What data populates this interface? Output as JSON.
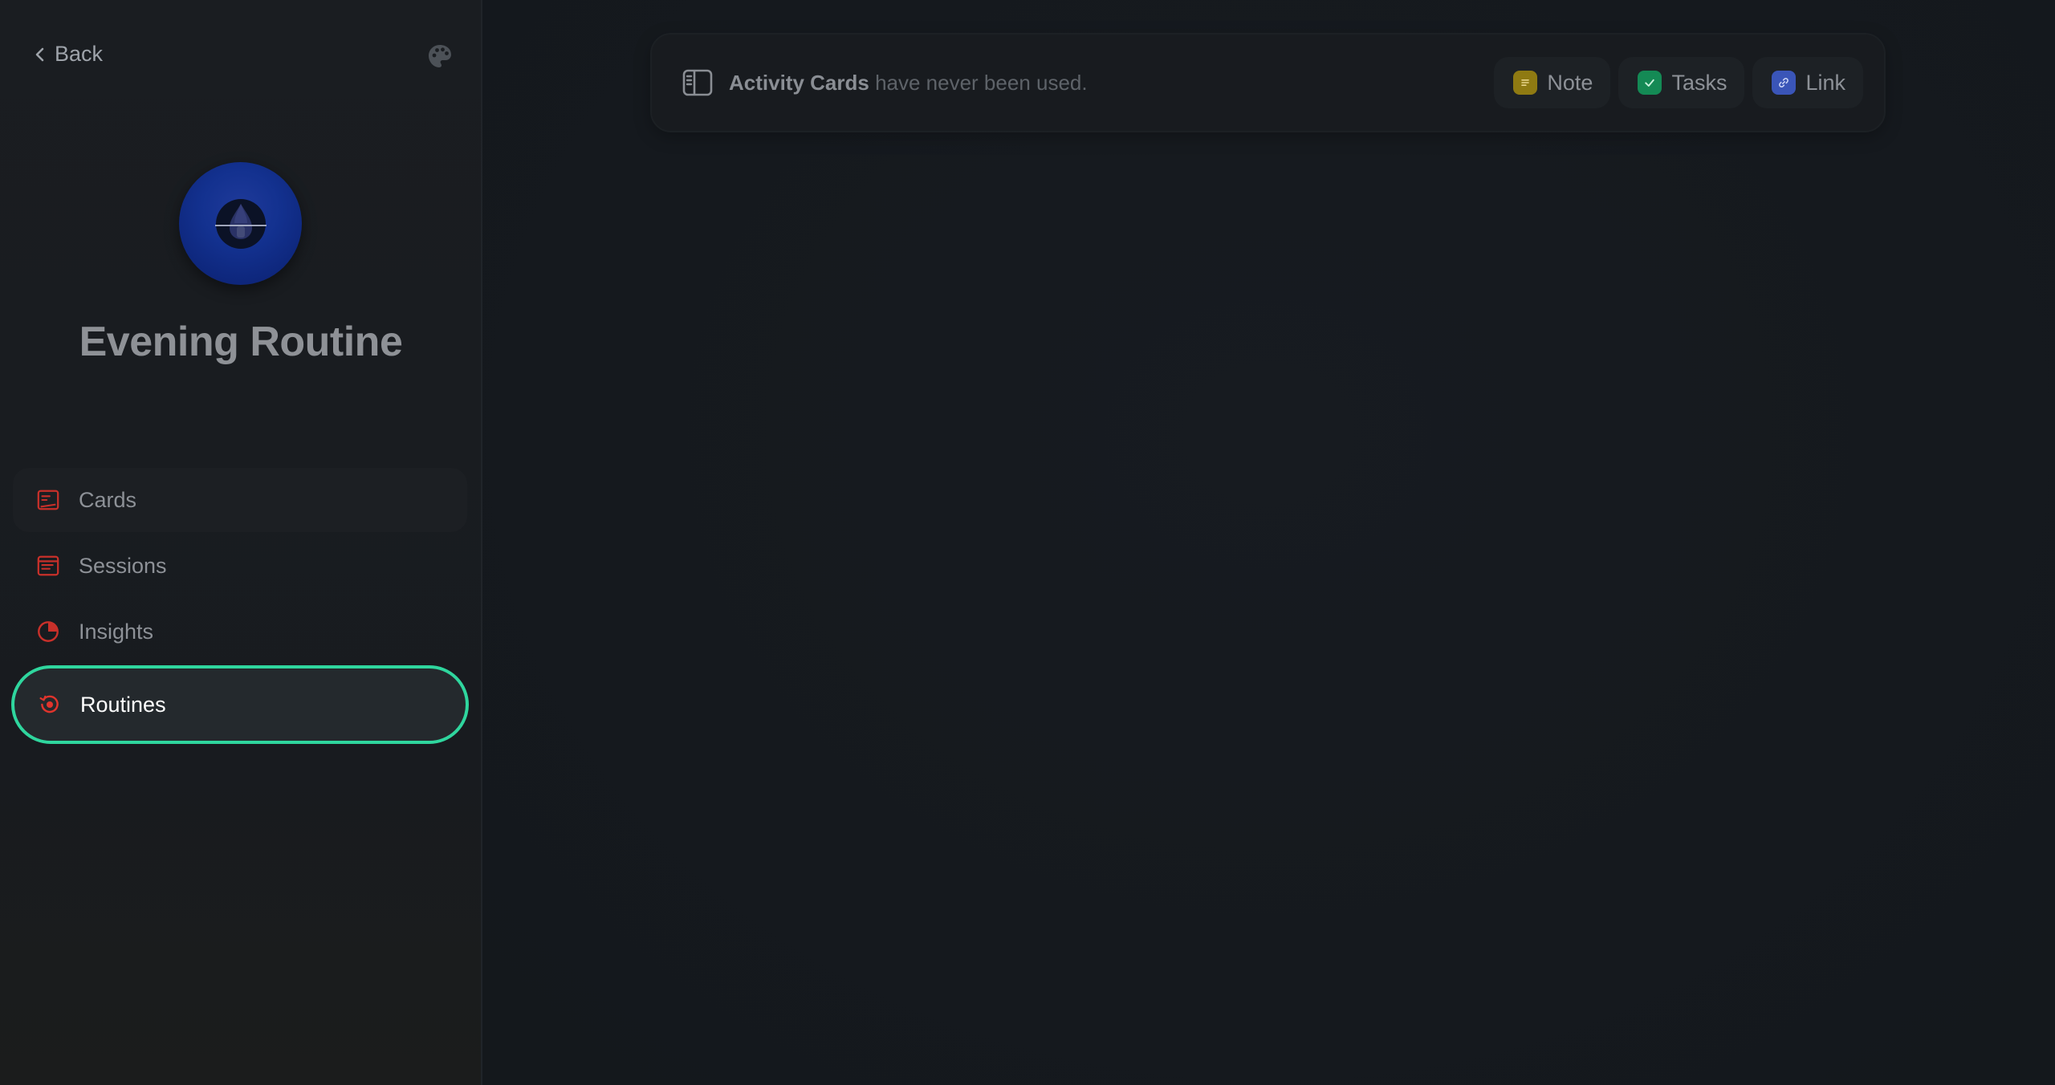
{
  "sidebar": {
    "back_label": "Back",
    "palette_icon": "palette-icon",
    "profile": {
      "title": "Evening Routine",
      "avatar_icon": "drop-icon",
      "avatar_color": "#13318f"
    },
    "nav": [
      {
        "label": "Cards",
        "icon": "cards-icon",
        "icon_color": "#c8302a"
      },
      {
        "label": "Sessions",
        "icon": "sessions-icon",
        "icon_color": "#c8302a"
      },
      {
        "label": "Insights",
        "icon": "pie-chart-icon",
        "icon_color": "#c8302a"
      },
      {
        "label": "Routines",
        "icon": "routine-icon",
        "icon_color": "#e0342c",
        "active": true
      }
    ],
    "active_border_color": "#2fd69e"
  },
  "toolbar": {
    "icon": "sidebar-panel-icon",
    "message_strong": "Activity Cards",
    "message_rest": " have never been used.",
    "chips": [
      {
        "label": "Note",
        "icon": "note-icon",
        "color": "#8f7a12"
      },
      {
        "label": "Tasks",
        "icon": "check-icon",
        "color": "#148a55"
      },
      {
        "label": "Link",
        "icon": "link-icon",
        "color": "#3a55b8"
      }
    ]
  }
}
